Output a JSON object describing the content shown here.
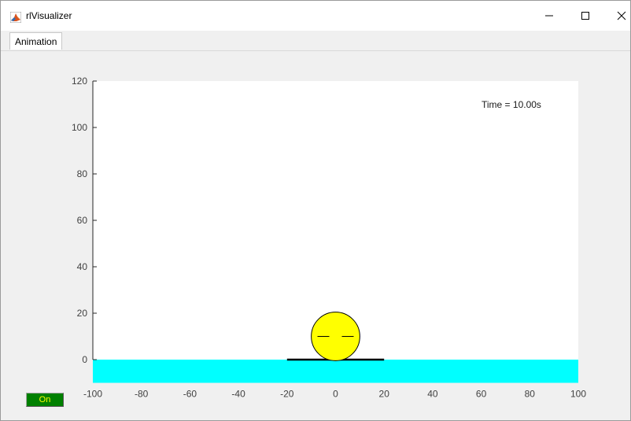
{
  "window": {
    "title": "rlVisualizer",
    "minimize_icon": "minimize-icon",
    "maximize_icon": "maximize-icon",
    "close_icon": "close-icon"
  },
  "menubar": {
    "tabs": [
      {
        "label": "Animation"
      }
    ]
  },
  "plot": {
    "time_label": "Time = 10.00s",
    "x_ticks": [
      "-100",
      "-80",
      "-60",
      "-40",
      "-20",
      "0",
      "20",
      "40",
      "60",
      "80",
      "100"
    ],
    "y_ticks": [
      "0",
      "20",
      "40",
      "60",
      "80",
      "100",
      "120"
    ],
    "xlim": [
      -100,
      100
    ],
    "ylim": [
      -10,
      120
    ],
    "water_color": "#00ffff",
    "water_top": 0,
    "water_bottom": -10,
    "platform": {
      "x1": -20,
      "x2": 20,
      "y": 0,
      "color": "#000000"
    },
    "ball": {
      "cx": 0,
      "cy": 10,
      "r": 10,
      "fill": "#ffff00",
      "stroke": "#000000"
    }
  },
  "controls": {
    "on_button_label": "On",
    "on_button_color": "#008000",
    "on_button_text_color": "#ffff00"
  }
}
